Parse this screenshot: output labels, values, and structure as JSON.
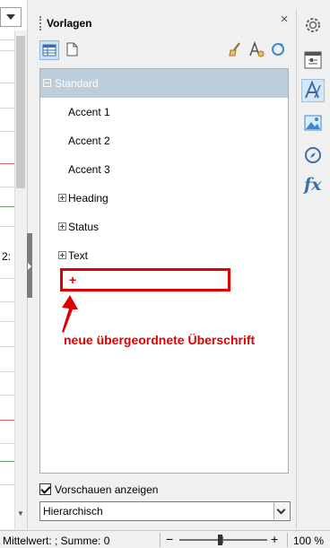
{
  "left_strip": {
    "cell_text": "2:"
  },
  "panel": {
    "title": "Vorlagen",
    "close_symbol": "×",
    "toolbar": {
      "paragraph_styles_icon": "paragraph-styles-icon",
      "page_styles_icon": "page-styles-icon",
      "fill_format_icon": "fill-format-icon",
      "new_style_icon": "new-style-icon",
      "update_style_icon": "update-style-icon"
    }
  },
  "styles": [
    {
      "label": "Standard",
      "level": 0,
      "expander": "minus",
      "selected": true
    },
    {
      "label": "Accent 1",
      "level": 1
    },
    {
      "label": "Accent 2",
      "level": 1
    },
    {
      "label": "Accent 3",
      "level": 1
    },
    {
      "label": "Heading",
      "level": 0,
      "expander": "plus"
    },
    {
      "label": "Status",
      "level": 0,
      "expander": "plus"
    },
    {
      "label": "Text",
      "level": 0,
      "expander": "plus"
    }
  ],
  "annotation": {
    "plus_symbol": "+",
    "text": "neue übergeordnete Überschrift",
    "color": "#e00000"
  },
  "preview_checkbox": {
    "label": "Vorschauen anzeigen",
    "checked": true
  },
  "filter_select": {
    "value": "Hierarchisch"
  },
  "deck": {
    "icons": [
      "settings-icon",
      "properties-icon",
      "styles-icon",
      "gallery-icon",
      "navigator-icon",
      "functions-icon"
    ],
    "functions_label": "fx"
  },
  "status_bar": {
    "summary": "Mittelwert: ; Summe: 0",
    "zoom_minus": "−",
    "zoom_plus": "+",
    "zoom_value": "100 %"
  }
}
